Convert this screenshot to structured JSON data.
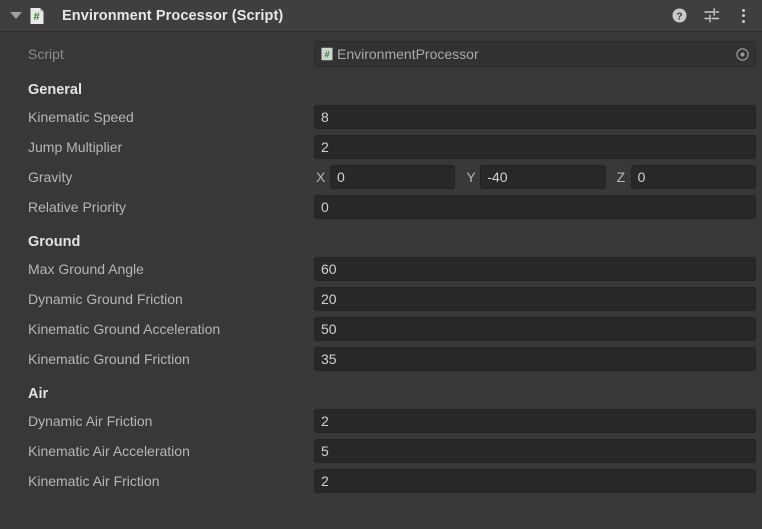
{
  "header": {
    "title": "Environment Processor (Script)",
    "foldout_icon": "triangle-down-icon",
    "script_asset_icon": "csharp-script-icon",
    "help_icon": "help-icon",
    "preset_icon": "preset-settings-icon",
    "menu_icon": "kebab-menu-icon"
  },
  "script_row": {
    "label": "Script",
    "value": "EnvironmentProcessor",
    "asset_icon": "csharp-script-icon",
    "picker_icon": "object-picker-icon"
  },
  "sections": [
    {
      "title": "General",
      "rows": [
        {
          "label": "Kinematic Speed",
          "value": "8",
          "type": "float"
        },
        {
          "label": "Jump Multiplier",
          "value": "2",
          "type": "float"
        },
        {
          "label": "Gravity",
          "type": "vector3",
          "components": [
            {
              "axis": "X",
              "value": "0"
            },
            {
              "axis": "Y",
              "value": "-40"
            },
            {
              "axis": "Z",
              "value": "0"
            }
          ]
        },
        {
          "label": "Relative Priority",
          "value": "0",
          "type": "int"
        }
      ]
    },
    {
      "title": "Ground",
      "rows": [
        {
          "label": "Max Ground Angle",
          "value": "60",
          "type": "float"
        },
        {
          "label": "Dynamic Ground Friction",
          "value": "20",
          "type": "float"
        },
        {
          "label": "Kinematic Ground Acceleration",
          "value": "50",
          "type": "float"
        },
        {
          "label": "Kinematic Ground Friction",
          "value": "35",
          "type": "float"
        }
      ]
    },
    {
      "title": "Air",
      "rows": [
        {
          "label": "Dynamic Air Friction",
          "value": "2",
          "type": "float"
        },
        {
          "label": "Kinematic Air Acceleration",
          "value": "5",
          "type": "float"
        },
        {
          "label": "Kinematic Air Friction",
          "value": "2",
          "type": "float"
        }
      ]
    }
  ],
  "colors": {
    "panel_background": "#383838",
    "header_background": "#3f3f3f",
    "field_background": "#282828",
    "readonly_field_background": "#323232",
    "label_text": "#b6b6b6",
    "heading_text": "#e3e3e3",
    "script_icon_green": "#2f7d32"
  }
}
